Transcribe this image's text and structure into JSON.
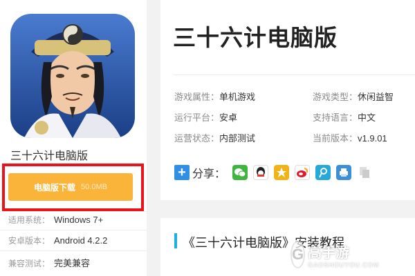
{
  "app": {
    "name": "三十六计电脑版",
    "download_label": "电脑版下载",
    "download_size": "50.0MB",
    "meta": [
      {
        "key": "适用系统：",
        "value": "Windows 7+"
      },
      {
        "key": "安卓版本：",
        "value": "Android 4.2.2"
      },
      {
        "key": "兼容测试：",
        "value": "完美兼容"
      }
    ]
  },
  "info": {
    "title": "三十六计电脑版",
    "attrs": [
      {
        "key": "游戏属性：",
        "value": "单机游戏"
      },
      {
        "key": "游戏类型：",
        "value": "休闲益智"
      },
      {
        "key": "运行平台：",
        "value": "安卓"
      },
      {
        "key": "支持语言：",
        "value": "中文"
      },
      {
        "key": "运营状态：",
        "value": "内部测试"
      },
      {
        "key": "当前版本：",
        "value": "v1.9.01"
      }
    ],
    "share_label": "分享：",
    "share_icons": [
      "wechat-icon",
      "qq-icon",
      "qzone-icon",
      "weibo-icon",
      "tencent-weibo-icon",
      "print-icon",
      "copy-icon"
    ]
  },
  "tutorial": {
    "title": "《三十六计电脑版》安装教程"
  },
  "watermark": {
    "cn": "高手游",
    "en": "GAOSHOUYOU.COM"
  },
  "colors": {
    "download_button": "#fbb43a",
    "highlight_frame": "#e8141a",
    "share_plus": "#2f8ee6",
    "section_bar": "#1ab0e0"
  }
}
